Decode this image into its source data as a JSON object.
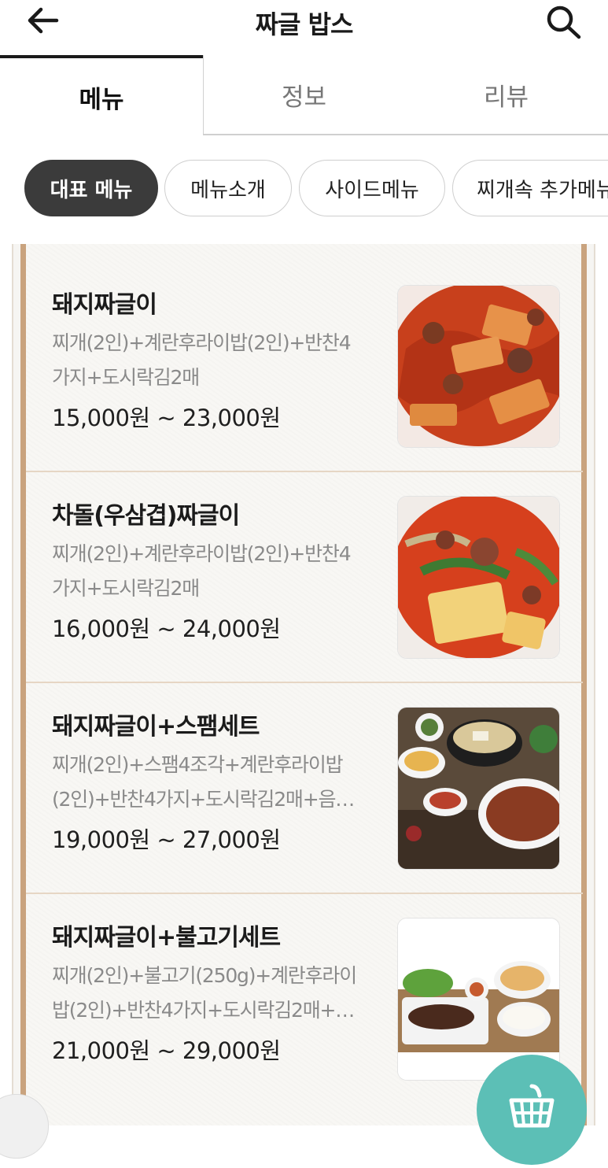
{
  "header": {
    "title": "짜글 밥스",
    "back_icon": "arrow-left-icon",
    "search_icon": "search-icon"
  },
  "tabs": [
    {
      "label": "메뉴",
      "active": true
    },
    {
      "label": "정보",
      "active": false
    },
    {
      "label": "리뷰",
      "active": false
    }
  ],
  "chips": [
    {
      "label": "대표 메뉴",
      "active": true
    },
    {
      "label": "메뉴소개",
      "active": false
    },
    {
      "label": "사이드메뉴",
      "active": false
    },
    {
      "label": "찌개속 추가메뉴",
      "active": false
    }
  ],
  "menu_items": [
    {
      "name": "돼지짜글이",
      "desc_line1": "찌개(2인)+계란후라이밥(2인)+반찬4",
      "desc_line2": "가지+도시락김2매",
      "price": "15,000원 ~ 23,000원"
    },
    {
      "name": "차돌(우삼겹)짜글이",
      "desc_line1": "찌개(2인)+계란후라이밥(2인)+반찬4",
      "desc_line2": "가지+도시락김2매",
      "price": "16,000원 ~ 24,000원"
    },
    {
      "name": "돼지짜글이+스팸세트",
      "desc_line1": "찌개(2인)+스팸4조각+계란후라이밥",
      "desc_line2": "(2인)+반찬4가지+도시락김2매+음…",
      "price": "19,000원 ~ 27,000원"
    },
    {
      "name": "돼지짜글이+불고기세트",
      "desc_line1": "찌개(2인)+불고기(250g)+계란후라이",
      "desc_line2": "밥(2인)+반찬4가지+도시락김2매+…",
      "price": "21,000원 ~ 29,000원"
    }
  ],
  "colors": {
    "accent_chip": "#3b3b3b",
    "rail": "#c9a37e",
    "fab": "#5cbfb6"
  },
  "fab_icon": "cart-icon"
}
